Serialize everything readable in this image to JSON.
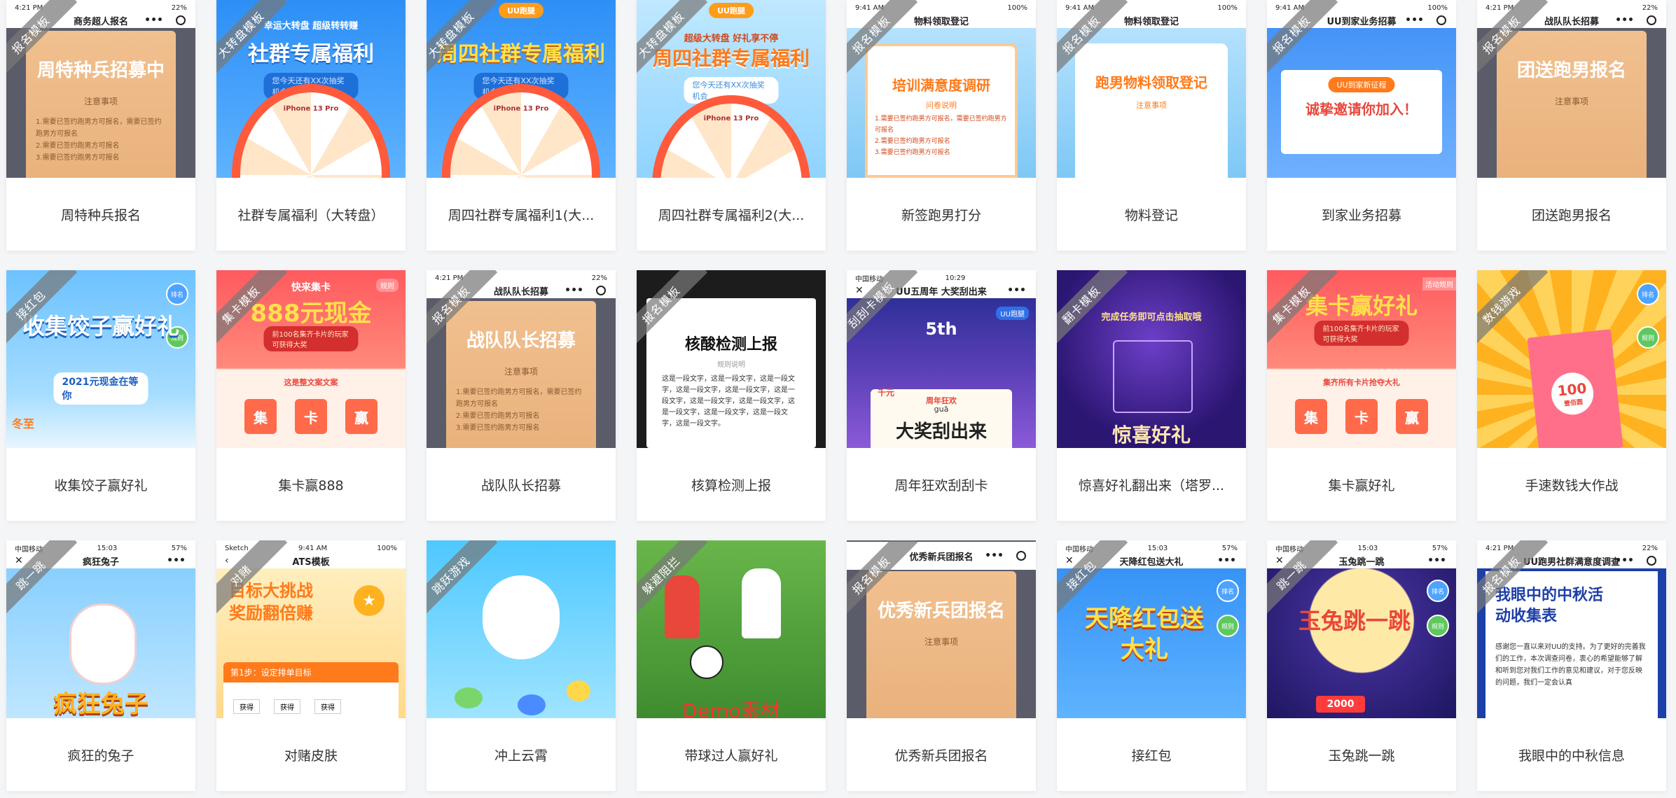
{
  "status": {
    "time_a": "4:21 PM",
    "time_b": "9:41 AM",
    "time_c": "15:03",
    "time_d": "10:29",
    "battery_a": "22%",
    "battery_b": "100%",
    "battery_c": "57%",
    "carrier_sketch": "Sketch",
    "carrier_cm": "中国移动"
  },
  "cards": [
    {
      "title": "周特种兵报名",
      "ribbon": "报名模板",
      "nav": "商务超人报名",
      "headline": "周特种兵招募中",
      "sub": "注意事项",
      "lines": [
        "1.需要已签约跑男方可报名，需要已签约跑男方可报名",
        "2.需要已签约跑男方可报名",
        "3.需要已签约跑男方可报名"
      ]
    },
    {
      "title": "社群专属福利（大转盘）",
      "ribbon": "大转盘模板",
      "top_text": "幸运大转盘 超级转转赚",
      "headline": "社群专属福利",
      "pill": "您今天还有XX次抽奖机会",
      "prize": "iPhone 13 Pro"
    },
    {
      "title": "周四社群专属福利1(大...",
      "ribbon": "大转盘模板",
      "logo": "UU跑腿",
      "headline": "周四社群专属福利",
      "pill": "您今天还有XX次抽奖机会",
      "prize": "iPhone 13 Pro"
    },
    {
      "title": "周四社群专属福利2(大...",
      "ribbon": "大转盘模板",
      "logo": "UU跑腿",
      "top_text": "超级大转盘 好礼享不停",
      "headline": "周四社群专属福利",
      "pill": "您今天还有XX次抽奖机会",
      "prize": "iPhone 13 Pro"
    },
    {
      "title": "新签跑男打分",
      "ribbon": "报名模板",
      "nav": "物料领取登记",
      "headline": "培训满意度调研",
      "sub": "问卷说明",
      "lines": [
        "1.需要已签约跑男方可报名，需要已签约跑男方可报名",
        "2.需要已签约跑男方可报名",
        "3.需要已签约跑男方可报名"
      ]
    },
    {
      "title": "物料登记",
      "ribbon": "报名模板",
      "nav": "物料领取登记",
      "headline": "跑男物料领取登记",
      "sub": "注意事项"
    },
    {
      "title": "到家业务招募",
      "ribbon": "报名模板",
      "nav": "UU到家业务招募",
      "pill": "UU到家新征程",
      "headline": "诚挚邀请你加入！"
    },
    {
      "title": "团送跑男报名",
      "ribbon": "报名模板",
      "nav": "战队队长招募",
      "headline": "团送跑男报名",
      "sub": "注意事项"
    },
    {
      "title": "收集饺子赢好礼",
      "ribbon": "接红包",
      "headline": "收集饺子赢好礼",
      "pill": "2021元现金在等你",
      "badge1": "排名",
      "badge2": "规则",
      "corner": "冬至"
    },
    {
      "title": "集卡赢888",
      "ribbon": "集卡模板",
      "top_text": "快来集卡",
      "headline": "888元现金",
      "pill": "前100名集齐卡片的玩家可获得大奖",
      "sub": "这是整文案文案",
      "cards3": [
        "集",
        "卡",
        "赢"
      ],
      "corner": "规则"
    },
    {
      "title": "战队队长招募",
      "ribbon": "报名模板",
      "nav": "战队队长招募",
      "headline": "战队队长招募",
      "sub": "注意事项",
      "lines": [
        "1.需要已签约跑男方可报名，需要已签约跑男方可报名",
        "2.需要已签约跑男方可报名",
        "3.需要已签约跑男方可报名"
      ]
    },
    {
      "title": "核算检测上报",
      "ribbon": "报名模板",
      "headline": "核酸检测上报",
      "sub": "规则说明",
      "body": "这是一段文字，这是一段文字，这是一段文字，这是一段文字，这是一段文字，这是一段文字，这是一段文字，这是一段文字，这是一段文字，这是一段文字，这是一段文字，这是一段文字。"
    },
    {
      "title": "周年狂欢刮刮卡",
      "ribbon": "刮刮卡模板",
      "nav": "UU五周年 大奖刮出来",
      "headline": "大奖刮出来",
      "pill": "周年狂欢",
      "corner": "UU跑腿",
      "top_num": "5th",
      "pinyin": "guā",
      "money": "千元"
    },
    {
      "title": "惊喜好礼翻出来（塔罗...",
      "ribbon": "翻卡模板",
      "top_text": "完成任务即可点击抽取哦",
      "headline": "惊喜好礼"
    },
    {
      "title": "集卡赢好礼",
      "ribbon": "集卡模板",
      "headline": "集卡赢好礼",
      "pill": "前100名集齐卡片的玩家可获得大奖",
      "sub": "集齐所有卡片抢夺大礼",
      "cards3": [
        "集",
        "卡",
        "赢"
      ],
      "corner": "活动规则"
    },
    {
      "title": "手速数钱大作战",
      "ribbon": "数钱游戏",
      "badge1": "排名",
      "badge2": "规则",
      "bill": "100",
      "bill_label": "壹佰圆"
    },
    {
      "title": "疯狂的兔子",
      "ribbon": "跳一跳",
      "nav": "疯狂兔子",
      "headline": "疯狂兔子"
    },
    {
      "title": "对赌皮肤",
      "ribbon": "对赌",
      "nav": "ATS模板",
      "headline": "目标大挑战",
      "sub": "奖励翻倍赚",
      "step": "第1步：设定排单目标",
      "btns": [
        "获得",
        "获得",
        "获得"
      ]
    },
    {
      "title": "冲上云霄",
      "ribbon": "跳跃游戏"
    },
    {
      "title": "带球过人赢好礼",
      "ribbon": "躲避阻拦",
      "watermark": "Demo素材"
    },
    {
      "title": "优秀新兵团报名",
      "ribbon": "报名模板",
      "nav": "优秀新兵团报名",
      "headline": "优秀新兵团报名",
      "sub": "注意事项"
    },
    {
      "title": "接红包",
      "ribbon": "接红包",
      "nav": "天降红包送大礼",
      "headline": "天降红包送大礼",
      "badge1": "排名",
      "badge2": "规则"
    },
    {
      "title": "玉兔跳一跳",
      "ribbon": "跳一跳",
      "nav": "玉兔跳一跳",
      "headline": "玉兔跳一跳",
      "badge1": "排名",
      "badge2": "规则",
      "money": "2000"
    },
    {
      "title": "我眼中的中秋信息",
      "ribbon": "报名模板",
      "nav": "UU跑男社群满意度调查",
      "headline": "我眼中的中秋活动收集表",
      "body": "感谢您一直以来对UU的支持。为了更好的完善我们的工作，本次调查问卷，衷心的希望能够了解和听到您对我们工作的意见和建议，对于您反映的问题，我们一定会认真"
    }
  ],
  "colors": {
    "ribbon": "#7d7d7d",
    "accent_blue": "#2f8df5",
    "accent_red": "#e9473c",
    "peach": "#efbd8b"
  }
}
